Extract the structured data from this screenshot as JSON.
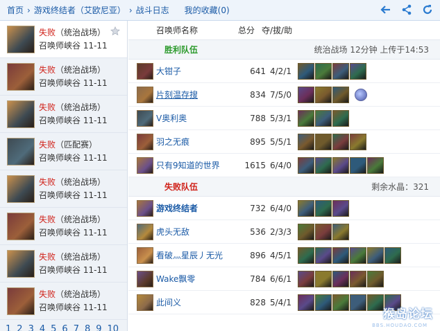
{
  "nav": {
    "home": "首页",
    "sep1": "›",
    "game": "游戏终结者（艾欧尼亚）",
    "sep2": "›",
    "battle_log": "战斗日志",
    "favorites": "我的收藏(0)",
    "icons": [
      "back-arrow-icon",
      "share-icon",
      "refresh-icon"
    ]
  },
  "sidebar": {
    "matches": [
      {
        "result": "失败",
        "mode": "（统治战场）",
        "map": "召唤师峡谷 11-11",
        "active": true
      },
      {
        "result": "失败",
        "mode": "（统治战场）",
        "map": "召唤师峡谷 11-11"
      },
      {
        "result": "失败",
        "mode": "（统治战场）",
        "map": "召唤师峡谷 11-11"
      },
      {
        "result": "失败",
        "mode": "（匹配赛）",
        "map": "召唤师峡谷 11-11"
      },
      {
        "result": "失败",
        "mode": "（统治战场）",
        "map": "召唤师峡谷 11-11"
      },
      {
        "result": "失败",
        "mode": "（统治战场）",
        "map": "召唤师峡谷 11-11"
      },
      {
        "result": "失败",
        "mode": "（统治战场）",
        "map": "召唤师峡谷 11-11"
      },
      {
        "result": "失败",
        "mode": "（统治战场）",
        "map": "召唤师峡谷 11-11"
      }
    ],
    "pages": [
      "1",
      "2",
      "3",
      "4",
      "5",
      "6",
      "7",
      "8",
      "9",
      "10"
    ]
  },
  "table": {
    "col_name": "召唤师名称",
    "col_score": "总分",
    "col_kda": "夺/拔/助"
  },
  "win_team": {
    "label": "胜利队伍",
    "info": "统治战场 12分钟 上传于14:53",
    "players": [
      {
        "name": "大钳子",
        "score": "641",
        "kda": "4/2/1",
        "items": 4,
        "underline": false
      },
      {
        "name": "片刻温存搜",
        "score": "834",
        "kda": "7/5/0",
        "items": 3,
        "trinket": true,
        "underline": true
      },
      {
        "name": "V奥利奥",
        "score": "788",
        "kda": "5/3/1",
        "items": 3,
        "underline": false
      },
      {
        "name": "羽之无痕",
        "score": "895",
        "kda": "5/5/1",
        "items": 4,
        "underline": false
      },
      {
        "name": "只有9知道的世界",
        "score": "1615",
        "kda": "6/4/0",
        "items": 5,
        "underline": false
      }
    ]
  },
  "lose_team": {
    "label": "失败队伍",
    "info": "剩余水晶：321",
    "players": [
      {
        "name": "游戏终结者",
        "score": "732",
        "kda": "6/4/0",
        "items": 3,
        "me": true
      },
      {
        "name": "虎头无敌",
        "score": "536",
        "kda": "2/3/3",
        "items": 3
      },
      {
        "name": "看破灬星辰丿无光",
        "score": "896",
        "kda": "4/5/1",
        "items": 6
      },
      {
        "name": "Wake飘零",
        "score": "784",
        "kda": "6/6/1",
        "items": 5
      },
      {
        "name": "此间义",
        "score": "828",
        "kda": "5/4/1",
        "items": 6
      }
    ]
  },
  "watermark": {
    "text": "猴岛论坛",
    "sub": "BBS.HOUDAO.COM"
  },
  "colors": {
    "win": "#2c9a2c",
    "lose": "#d0221a",
    "link": "#1a5aa6"
  }
}
